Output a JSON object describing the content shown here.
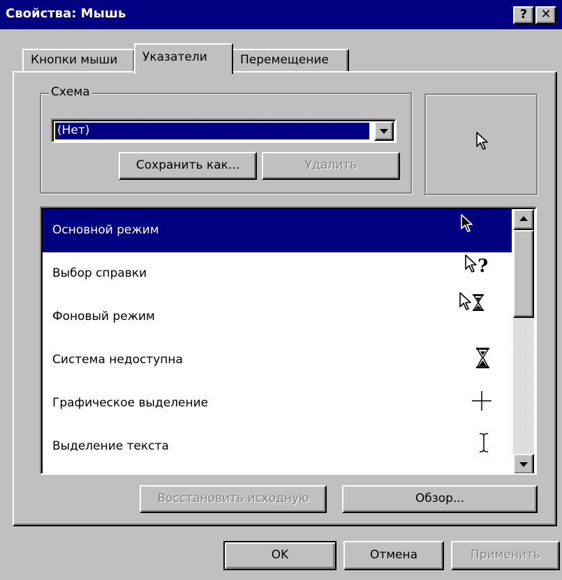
{
  "window": {
    "title": "Свойства: Мышь"
  },
  "title_buttons": {
    "help": "?",
    "close": "✕"
  },
  "tabs": [
    {
      "label": "Кнопки мыши"
    },
    {
      "label": "Указатели"
    },
    {
      "label": "Перемещение"
    }
  ],
  "scheme": {
    "group_label": "Схема",
    "selected": "(Нет)",
    "save_label": "Сохранить как...",
    "delete_label": "Удалить"
  },
  "cursors": [
    {
      "label": "Основной режим",
      "icon": "arrow-cursor-icon",
      "selected": true
    },
    {
      "label": "Выбор справки",
      "icon": "help-select-cursor-icon"
    },
    {
      "label": "Фоновый режим",
      "icon": "working-in-background-cursor-icon"
    },
    {
      "label": "Система недоступна",
      "icon": "hourglass-cursor-icon"
    },
    {
      "label": "Графическое выделение",
      "icon": "crosshair-cursor-icon"
    },
    {
      "label": "Выделение текста",
      "icon": "text-select-cursor-icon"
    }
  ],
  "buttons": {
    "restore_default": "Восстановить исходную",
    "browse": "Обзор...",
    "ok": "OK",
    "cancel": "Отмена",
    "apply": "Применить"
  },
  "colors": {
    "titlebar": "#000080",
    "face": "#c0c0c0",
    "selection": "#000080"
  }
}
